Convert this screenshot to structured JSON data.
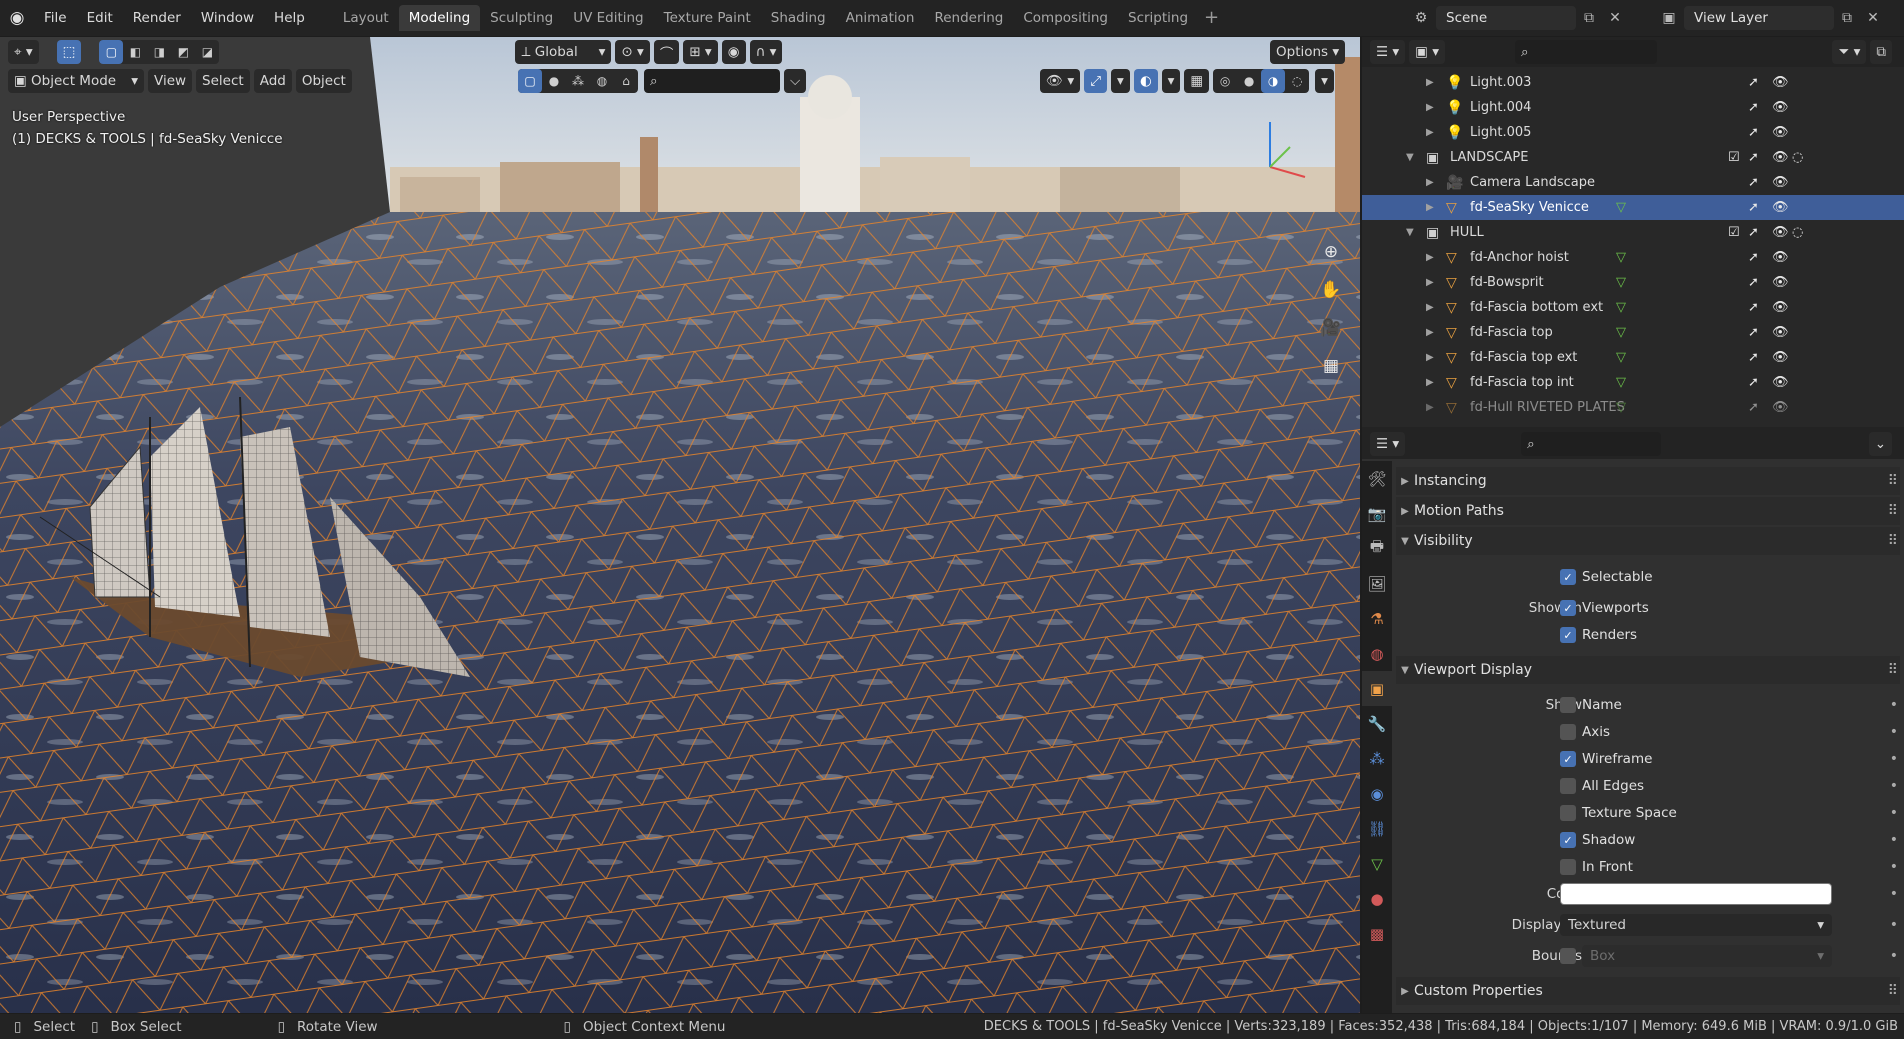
{
  "topbar": {
    "menus": [
      "File",
      "Edit",
      "Render",
      "Window",
      "Help"
    ],
    "tabs": [
      "Layout",
      "Modeling",
      "Sculpting",
      "UV Editing",
      "Texture Paint",
      "Shading",
      "Animation",
      "Rendering",
      "Compositing",
      "Scripting"
    ],
    "active_tab": "Modeling",
    "scene": "Scene",
    "view_layer": "View Layer"
  },
  "viewport": {
    "orientation": "Global",
    "options": "Options",
    "mode": "Object Mode",
    "menus": [
      "View",
      "Select",
      "Add",
      "Object"
    ],
    "perspective_label": "User Perspective",
    "object_label": "(1) DECKS & TOOLS | fd-SeaSky Venicce"
  },
  "outliner": {
    "rows": [
      {
        "name": "Light.003",
        "type": "light",
        "indent": 2
      },
      {
        "name": "Light.004",
        "type": "light",
        "indent": 2
      },
      {
        "name": "Light.005",
        "type": "light",
        "indent": 2
      },
      {
        "name": "LANDSCAPE",
        "type": "collection",
        "indent": 1
      },
      {
        "name": "Camera Landscape",
        "type": "camera",
        "indent": 2
      },
      {
        "name": "fd-SeaSky Venicce",
        "type": "mesh",
        "indent": 2,
        "selected": true
      },
      {
        "name": "HULL",
        "type": "collection",
        "indent": 1
      },
      {
        "name": "fd-Anchor hoist",
        "type": "mesh",
        "indent": 2
      },
      {
        "name": "fd-Bowsprit",
        "type": "mesh",
        "indent": 2
      },
      {
        "name": "fd-Fascia bottom ext",
        "type": "mesh",
        "indent": 2
      },
      {
        "name": "fd-Fascia top",
        "type": "mesh",
        "indent": 2
      },
      {
        "name": "fd-Fascia top ext",
        "type": "mesh",
        "indent": 2
      },
      {
        "name": "fd-Fascia top int",
        "type": "mesh",
        "indent": 2
      },
      {
        "name": "fd-Hull RIVETED PLATES",
        "type": "mesh",
        "indent": 2,
        "dim": true
      }
    ]
  },
  "properties": {
    "sections": {
      "instancing": "Instancing",
      "motion_paths": "Motion Paths",
      "visibility": "Visibility",
      "viewport_display": "Viewport Display",
      "custom_properties": "Custom Properties"
    },
    "visibility": {
      "selectable": "Selectable",
      "show_in_label": "Show In",
      "viewports": "Viewports",
      "renders": "Renders"
    },
    "viewport_display": {
      "show_label": "Show",
      "name": "Name",
      "axis": "Axis",
      "wireframe": "Wireframe",
      "all_edges": "All Edges",
      "texture_space": "Texture Space",
      "shadow": "Shadow",
      "in_front": "In Front",
      "color_label": "Color",
      "color_value": "#ffffff",
      "display_as_label": "Display As",
      "display_as_value": "Textured",
      "bounds_label": "Bounds",
      "bounds_value": "Box"
    }
  },
  "statusbar": {
    "select": "Select",
    "box_select": "Box Select",
    "rotate_view": "Rotate View",
    "context_menu": "Object Context Menu",
    "stats": "DECKS & TOOLS | fd-SeaSky Venicce | Verts:323,189 | Faces:352,438 | Tris:684,184 | Objects:1/107 | Memory: 649.6 MiB | VRAM: 0.9/1.0 GiB"
  },
  "colors": {
    "accent": "#4772b3",
    "wire": "#e8852a",
    "selected_row": "#3f5e99"
  }
}
